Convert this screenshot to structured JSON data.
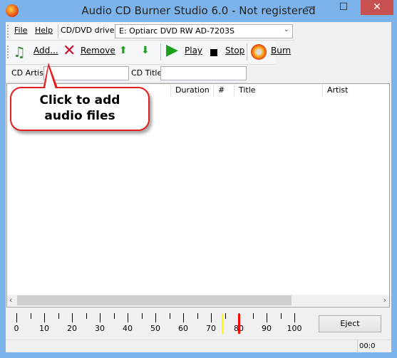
{
  "window": {
    "title": "Audio CD Burner Studio 6.0 - Not registered",
    "minimize": "—",
    "maximize": "☐",
    "close": "✕"
  },
  "menu": {
    "file": "File",
    "help": "Help",
    "drives_label": "CD/DVD drives",
    "drive_selected": "E: Optiarc DVD RW AD-7203S"
  },
  "toolbar": {
    "add": "Add...",
    "remove": "Remove",
    "play": "Play",
    "stop": "Stop",
    "burn": "Burn"
  },
  "fields": {
    "cd_artist_label": "CD Artist",
    "cd_artist_value": "",
    "cd_title_label": "CD Title",
    "cd_title_value": ""
  },
  "list": {
    "columns": [
      "",
      "Duration",
      "#",
      "Title",
      "Artist"
    ]
  },
  "callout": {
    "line1": "Click to add",
    "line2": "audio files"
  },
  "ruler": {
    "labels": [
      "0",
      "10",
      "20",
      "30",
      "40",
      "50",
      "60",
      "70",
      "80",
      "90",
      "100"
    ],
    "yellow_marker": 74,
    "red_marker": 80,
    "colors": {
      "yellow": "#ffff00",
      "red": "#ff0000"
    }
  },
  "eject": "Eject",
  "status": {
    "time": "00:0"
  }
}
